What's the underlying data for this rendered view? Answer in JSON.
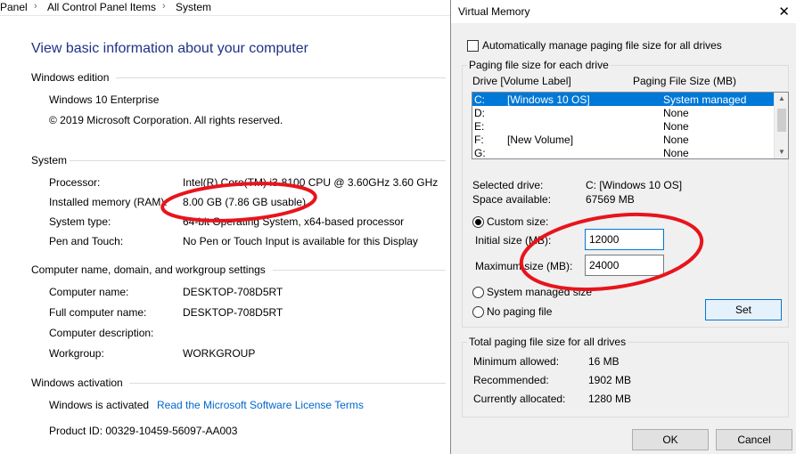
{
  "breadcrumb": {
    "items": [
      "Panel",
      "All Control Panel Items",
      "System"
    ]
  },
  "system": {
    "title": "View basic information about your computer",
    "edition": {
      "header": "Windows edition",
      "name": "Windows 10 Enterprise",
      "copyright": "© 2019 Microsoft Corporation. All rights reserved."
    },
    "system_section": {
      "header": "System",
      "rows": [
        {
          "label": "Processor:",
          "value": "Intel(R) Core(TM) i3-8100 CPU @ 3.60GHz   3.60 GHz"
        },
        {
          "label": "Installed memory (RAM):",
          "value": "8.00 GB (7.86 GB usable)"
        },
        {
          "label": "System type:",
          "value": "64-bit Operating System, x64-based processor"
        },
        {
          "label": "Pen and Touch:",
          "value": "No Pen or Touch Input is available for this Display"
        }
      ]
    },
    "computer_section": {
      "header": "Computer name, domain, and workgroup settings",
      "rows": [
        {
          "label": "Computer name:",
          "value": "DESKTOP-708D5RT"
        },
        {
          "label": "Full computer name:",
          "value": "DESKTOP-708D5RT"
        },
        {
          "label": "Computer description:",
          "value": ""
        },
        {
          "label": "Workgroup:",
          "value": "WORKGROUP"
        }
      ]
    },
    "activation": {
      "header": "Windows activation",
      "status": "Windows is activated",
      "link": "Read the Microsoft Software License Terms",
      "product_id": "Product ID: 00329-10459-56097-AA003"
    }
  },
  "vm": {
    "title": "Virtual Memory",
    "close_glyph": "✕",
    "auto_manage_label": "Automatically manage paging file size for all drives",
    "auto_manage_checked": false,
    "group_title": "Paging file size for each drive",
    "col_drive": "Drive  [Volume Label]",
    "col_size": "Paging File Size (MB)",
    "drives": [
      {
        "drive": "C:",
        "label": "[Windows 10 OS]",
        "size": "System managed",
        "selected": true
      },
      {
        "drive": "D:",
        "label": "",
        "size": "None",
        "selected": false
      },
      {
        "drive": "E:",
        "label": "",
        "size": "None",
        "selected": false
      },
      {
        "drive": "F:",
        "label": "[New Volume]",
        "size": "None",
        "selected": false
      },
      {
        "drive": "G:",
        "label": "",
        "size": "None",
        "selected": false
      }
    ],
    "selected_drive_label": "Selected drive:",
    "selected_drive_value": "C:  [Windows 10 OS]",
    "space_label": "Space available:",
    "space_value": "67569 MB",
    "custom_size_label": "Custom size:",
    "initial_label": "Initial size (MB):",
    "initial_value": "12000",
    "max_label": "Maximum size (MB):",
    "max_value": "24000",
    "system_managed_label": "System managed size",
    "no_paging_label": "No paging file",
    "selected_option": "custom",
    "set_button": "Set",
    "totals_title": "Total paging file size for all drives",
    "min_label": "Minimum allowed:",
    "min_value": "16 MB",
    "rec_label": "Recommended:",
    "rec_value": "1902 MB",
    "alloc_label": "Currently allocated:",
    "alloc_value": "1280 MB",
    "ok_button": "OK",
    "cancel_button": "Cancel"
  },
  "colors": {
    "title_blue": "#1e3287",
    "link_blue": "#0066cc",
    "selection": "#0078d7",
    "annotation_red": "#e8141c"
  }
}
